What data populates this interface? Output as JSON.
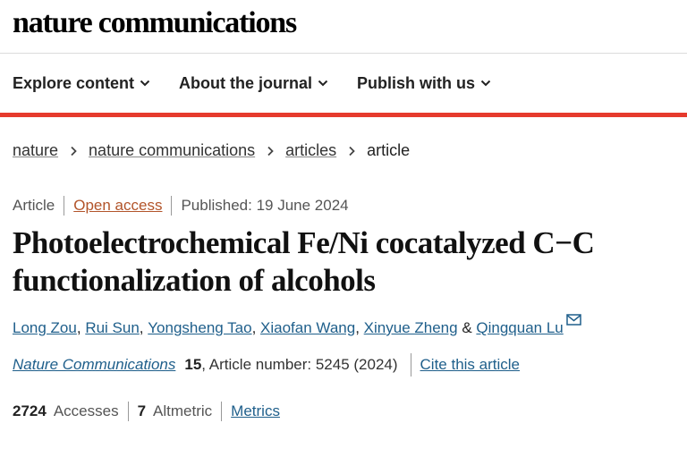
{
  "masthead": {
    "logo_text": "nature communications"
  },
  "nav": {
    "items": [
      {
        "label": "Explore content"
      },
      {
        "label": "About the journal"
      },
      {
        "label": "Publish with us"
      }
    ]
  },
  "breadcrumb": {
    "items": [
      "nature",
      "nature communications",
      "articles"
    ],
    "current": "article"
  },
  "meta": {
    "type": "Article",
    "access": "Open access",
    "published": "Published: 19 June 2024"
  },
  "article": {
    "title_line1": "Photoelectrochemical Fe/Ni cocatalyzed C−C",
    "title_line2": "functionalization of alcohols"
  },
  "authors": {
    "list": [
      "Long Zou",
      "Rui Sun",
      "Yongsheng Tao",
      "Xiaofan Wang",
      "Xinyue Zheng"
    ],
    "last": "Qingquan Lu",
    "separator": ",",
    "conjunction": "&"
  },
  "citation": {
    "journal": "Nature Communications",
    "volume": "15",
    "details": ", Article number: 5245 (2024)",
    "cite_label": "Cite this article"
  },
  "metrics": {
    "accesses_count": "2724",
    "accesses_label": "Accesses",
    "altmetric_count": "7",
    "altmetric_label": "Altmetric",
    "metrics_label": "Metrics"
  },
  "colors": {
    "accent_bar": "#e63a2d",
    "link": "#1f5f8b",
    "open_access": "#b2542a"
  },
  "icons": {
    "nav_dropdown": "chevron-down-icon",
    "breadcrumb_separator": "chevron-right-icon",
    "corresponding_author": "envelope-icon"
  }
}
